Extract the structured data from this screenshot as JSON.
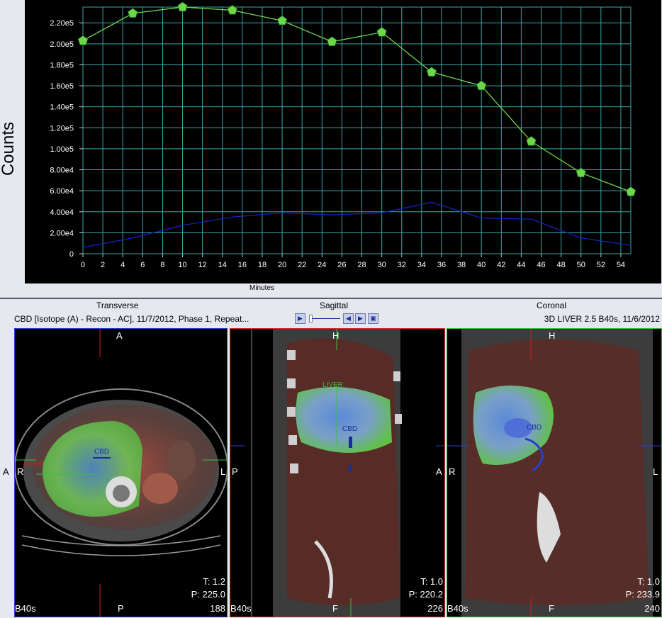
{
  "chart": {
    "ylabel": "Counts",
    "xlabel": "Minutes"
  },
  "chart_data": {
    "type": "line",
    "x": [
      0,
      5,
      10,
      15,
      20,
      25,
      30,
      35,
      40,
      45,
      50,
      55
    ],
    "series": [
      {
        "name": "",
        "color": "#6cd848",
        "marker": "pentagon",
        "values": [
          203000,
          229000,
          235000,
          232000,
          222000,
          202000,
          211000,
          173000,
          160000,
          107000,
          77000,
          59000
        ]
      },
      {
        "name": "",
        "color": "#1a22b8",
        "marker": "none",
        "values": [
          6000,
          15000,
          27000,
          35000,
          39000,
          37000,
          39000,
          49000,
          34000,
          33000,
          15000,
          8000
        ]
      }
    ],
    "xticks": [
      0,
      2,
      4,
      6,
      8,
      10,
      12,
      14,
      16,
      18,
      20,
      22,
      24,
      26,
      28,
      30,
      32,
      34,
      36,
      38,
      40,
      42,
      44,
      46,
      48,
      50,
      52,
      54
    ],
    "yticks": [
      0,
      20000,
      40000,
      60000,
      80000,
      100000,
      120000,
      140000,
      160000,
      180000,
      200000,
      220000
    ],
    "ytick_labels": [
      "0",
      "2.00e4",
      "4.00e4",
      "6.00e4",
      "8.00e4",
      "1.00e5",
      "1.20e5",
      "1.40e5",
      "1.60e5",
      "1.80e5",
      "2.00e5",
      "2.20e5"
    ],
    "xlim": [
      0,
      55
    ],
    "ylim": [
      0,
      235000
    ],
    "grid": true,
    "ylabel": "Counts",
    "xlabel": "Minutes"
  },
  "views": {
    "transverse_title": "Transverse",
    "sagittal_title": "Sagittal",
    "coronal_title": "Coronal",
    "series_info": "CBD [Isotope  (A) - Recon - AC], 11/7/2012, Phase 1, Repeat...",
    "recon_info": "3D LIVER 2.5  B40s, 11/6/2012"
  },
  "panels": {
    "transverse": {
      "top": "A",
      "bottom": "P",
      "left": "R",
      "right": "L",
      "outer_left": "A",
      "t": "T: 1.2",
      "p": "P: 225.0",
      "slice": "188",
      "kernel": "B40s",
      "roi_liver": "LIVER",
      "roi_cbd": "CBD"
    },
    "sagittal": {
      "top": "H",
      "bottom": "F",
      "left": "P",
      "right": "A",
      "t": "T: 1.0",
      "p": "P: 220.2",
      "slice": "226",
      "kernel": "B40s",
      "roi_liver": "LIVER",
      "roi_cbd": "CBD"
    },
    "coronal": {
      "top": "H",
      "bottom": "F",
      "left": "R",
      "right": "L",
      "t": "T: 1.0",
      "p": "P: 233.9",
      "slice": "240",
      "kernel": "B40s",
      "roi_cbd": "CBD"
    }
  },
  "colors": {
    "grid": "#3aa6a6",
    "green_series": "#6cd848",
    "blue_series": "#1a22b8",
    "plot_bg": "#000000"
  }
}
